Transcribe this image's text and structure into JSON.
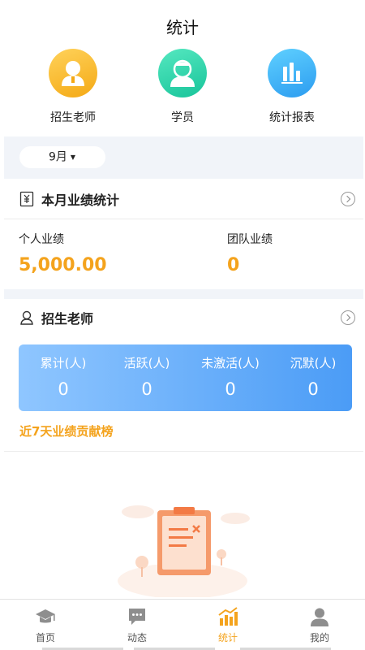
{
  "header": {
    "title": "统计"
  },
  "quick_actions": [
    {
      "label": "招生老师",
      "icon": "person-avatar-icon"
    },
    {
      "label": "学员",
      "icon": "student-avatar-icon"
    },
    {
      "label": "统计报表",
      "icon": "bar-chart-icon"
    }
  ],
  "month_filter": {
    "value": "9月"
  },
  "monthly_performance": {
    "title": "本月业绩统计",
    "personal": {
      "label": "个人业绩",
      "value": "5,000.00"
    },
    "team": {
      "label": "团队业绩",
      "value": "0"
    }
  },
  "recruit_teachers": {
    "title": "招生老师",
    "stats": [
      {
        "label": "累计(人)",
        "value": "0"
      },
      {
        "label": "活跃(人)",
        "value": "0"
      },
      {
        "label": "未激活(人)",
        "value": "0"
      },
      {
        "label": "沉默(人)",
        "value": "0"
      }
    ],
    "ranking_title": "近7天业绩贡献榜"
  },
  "tabbar": {
    "items": [
      {
        "label": "首页",
        "icon": "graduation-cap-icon"
      },
      {
        "label": "动态",
        "icon": "chat-bubble-icon"
      },
      {
        "label": "统计",
        "icon": "stats-chart-icon"
      },
      {
        "label": "我的",
        "icon": "user-icon"
      }
    ],
    "active": "统计"
  },
  "colors": {
    "accent": "#f4a31d",
    "card_gradient_start": "#8fc6ff",
    "card_gradient_end": "#4b9cf6",
    "strip_bg": "#f1f4f9"
  }
}
